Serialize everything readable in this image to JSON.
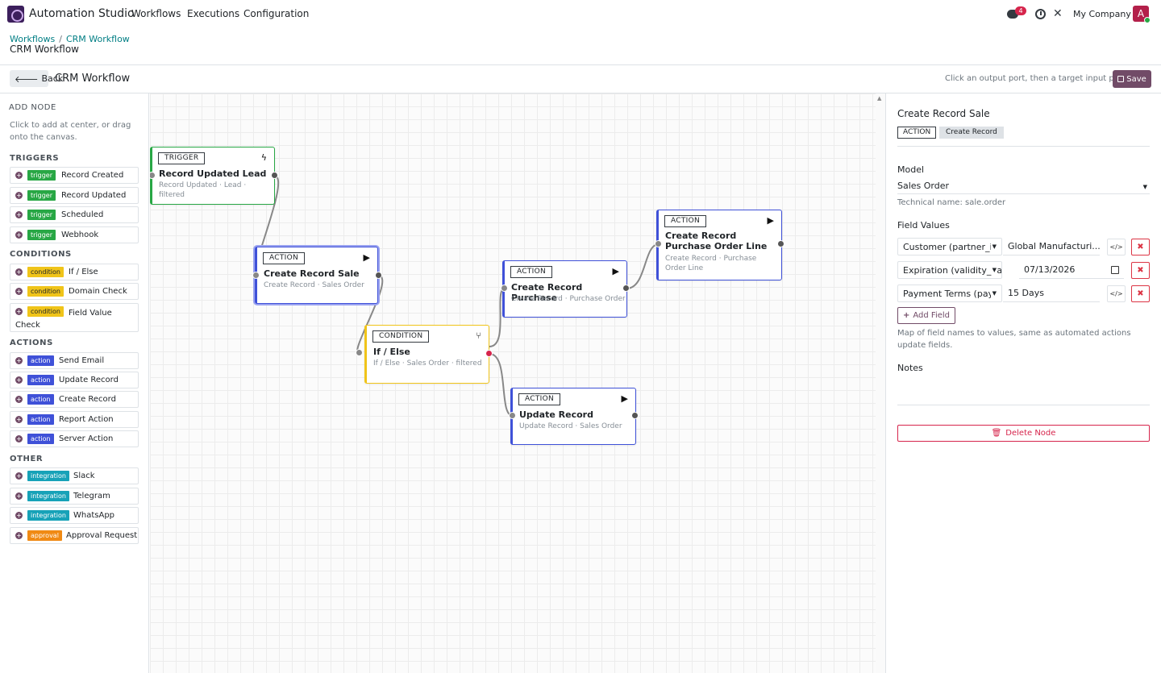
{
  "navbar": {
    "app_name": "Automation Studio",
    "menu": [
      "Workflows",
      "Executions",
      "Configuration"
    ],
    "chat_badge": "4",
    "company": "My Company",
    "avatar_initial": "A"
  },
  "breadcrumb": {
    "items": [
      "Workflows",
      "CRM Workflow"
    ],
    "title": "CRM Workflow"
  },
  "toolbar": {
    "back_label": "Back",
    "workflow_title": "CRM Workflow",
    "hint": "Click an output port, then a target input port",
    "save_label": "Save"
  },
  "palette": {
    "heading": "ADD NODE",
    "help": "Click to add at center, or drag onto the canvas.",
    "groups": [
      {
        "title": "TRIGGERS",
        "items": [
          {
            "tag": "trigger",
            "label": "Record Created"
          },
          {
            "tag": "trigger",
            "label": "Record Updated"
          },
          {
            "tag": "trigger",
            "label": "Scheduled"
          },
          {
            "tag": "trigger",
            "label": "Webhook"
          }
        ]
      },
      {
        "title": "CONDITIONS",
        "items": [
          {
            "tag": "condition",
            "label": "If / Else"
          },
          {
            "tag": "condition",
            "label": "Domain Check"
          },
          {
            "tag": "condition",
            "label": "Field Value Check"
          }
        ]
      },
      {
        "title": "ACTIONS",
        "items": [
          {
            "tag": "action",
            "label": "Send Email"
          },
          {
            "tag": "action",
            "label": "Update Record"
          },
          {
            "tag": "action",
            "label": "Create Record"
          },
          {
            "tag": "action",
            "label": "Report Action"
          },
          {
            "tag": "action",
            "label": "Server Action"
          }
        ]
      },
      {
        "title": "OTHER",
        "items": [
          {
            "tag": "integration",
            "label": "Slack"
          },
          {
            "tag": "integration",
            "label": "Telegram"
          },
          {
            "tag": "integration",
            "label": "WhatsApp"
          },
          {
            "tag": "approval",
            "label": "Approval Request"
          }
        ]
      }
    ]
  },
  "nodes": {
    "n1": {
      "type": "TRIGGER",
      "title": "Record Updated Lead",
      "subtitle": "Record Updated · Lead · filtered",
      "icon": "bolt-icon"
    },
    "n2": {
      "type": "ACTION",
      "title": "Create Record Sale",
      "subtitle": "Create Record · Sales Order",
      "icon": "play-icon"
    },
    "n3": {
      "type": "CONDITION",
      "title": "If / Else",
      "subtitle": "If / Else · Sales Order · filtered",
      "icon": "branch-icon"
    },
    "n4": {
      "type": "ACTION",
      "title": "Create Record Purchase",
      "subtitle": "Create Record · Purchase Order",
      "icon": "play-icon"
    },
    "n5": {
      "type": "ACTION",
      "title": "Create Record Purchase Order Line",
      "subtitle": "Create Record · Purchase Order Line",
      "icon": "play-icon"
    },
    "n6": {
      "type": "ACTION",
      "title": "Update Record",
      "subtitle": "Update Record · Sales Order",
      "icon": "play-icon"
    }
  },
  "inspector": {
    "title": "Create Record Sale",
    "type_tag": "ACTION",
    "kind_tag": "Create Record",
    "model_label": "Model",
    "model_value": "Sales Order",
    "technical_name": "Technical name: sale.order",
    "field_values_label": "Field Values",
    "fields": [
      {
        "key": "Customer (partner_i",
        "value": "Global Manufacturi..."
      },
      {
        "key": "Expiration (validity_dat",
        "value": "07/13/2026"
      },
      {
        "key": "Payment Terms (pay",
        "value": "15 Days"
      }
    ],
    "add_field_label": "Add Field",
    "field_help": "Map of field names to values, same as automated actions update fields.",
    "notes_label": "Notes",
    "delete_label": "Delete Node"
  },
  "colors": {
    "brand": "#714b67",
    "trigger": "#28a745",
    "action": "#3f51d8",
    "condition": "#f0c419",
    "integration": "#17a2b8",
    "approval": "#f08a14",
    "danger": "#d6254c"
  }
}
